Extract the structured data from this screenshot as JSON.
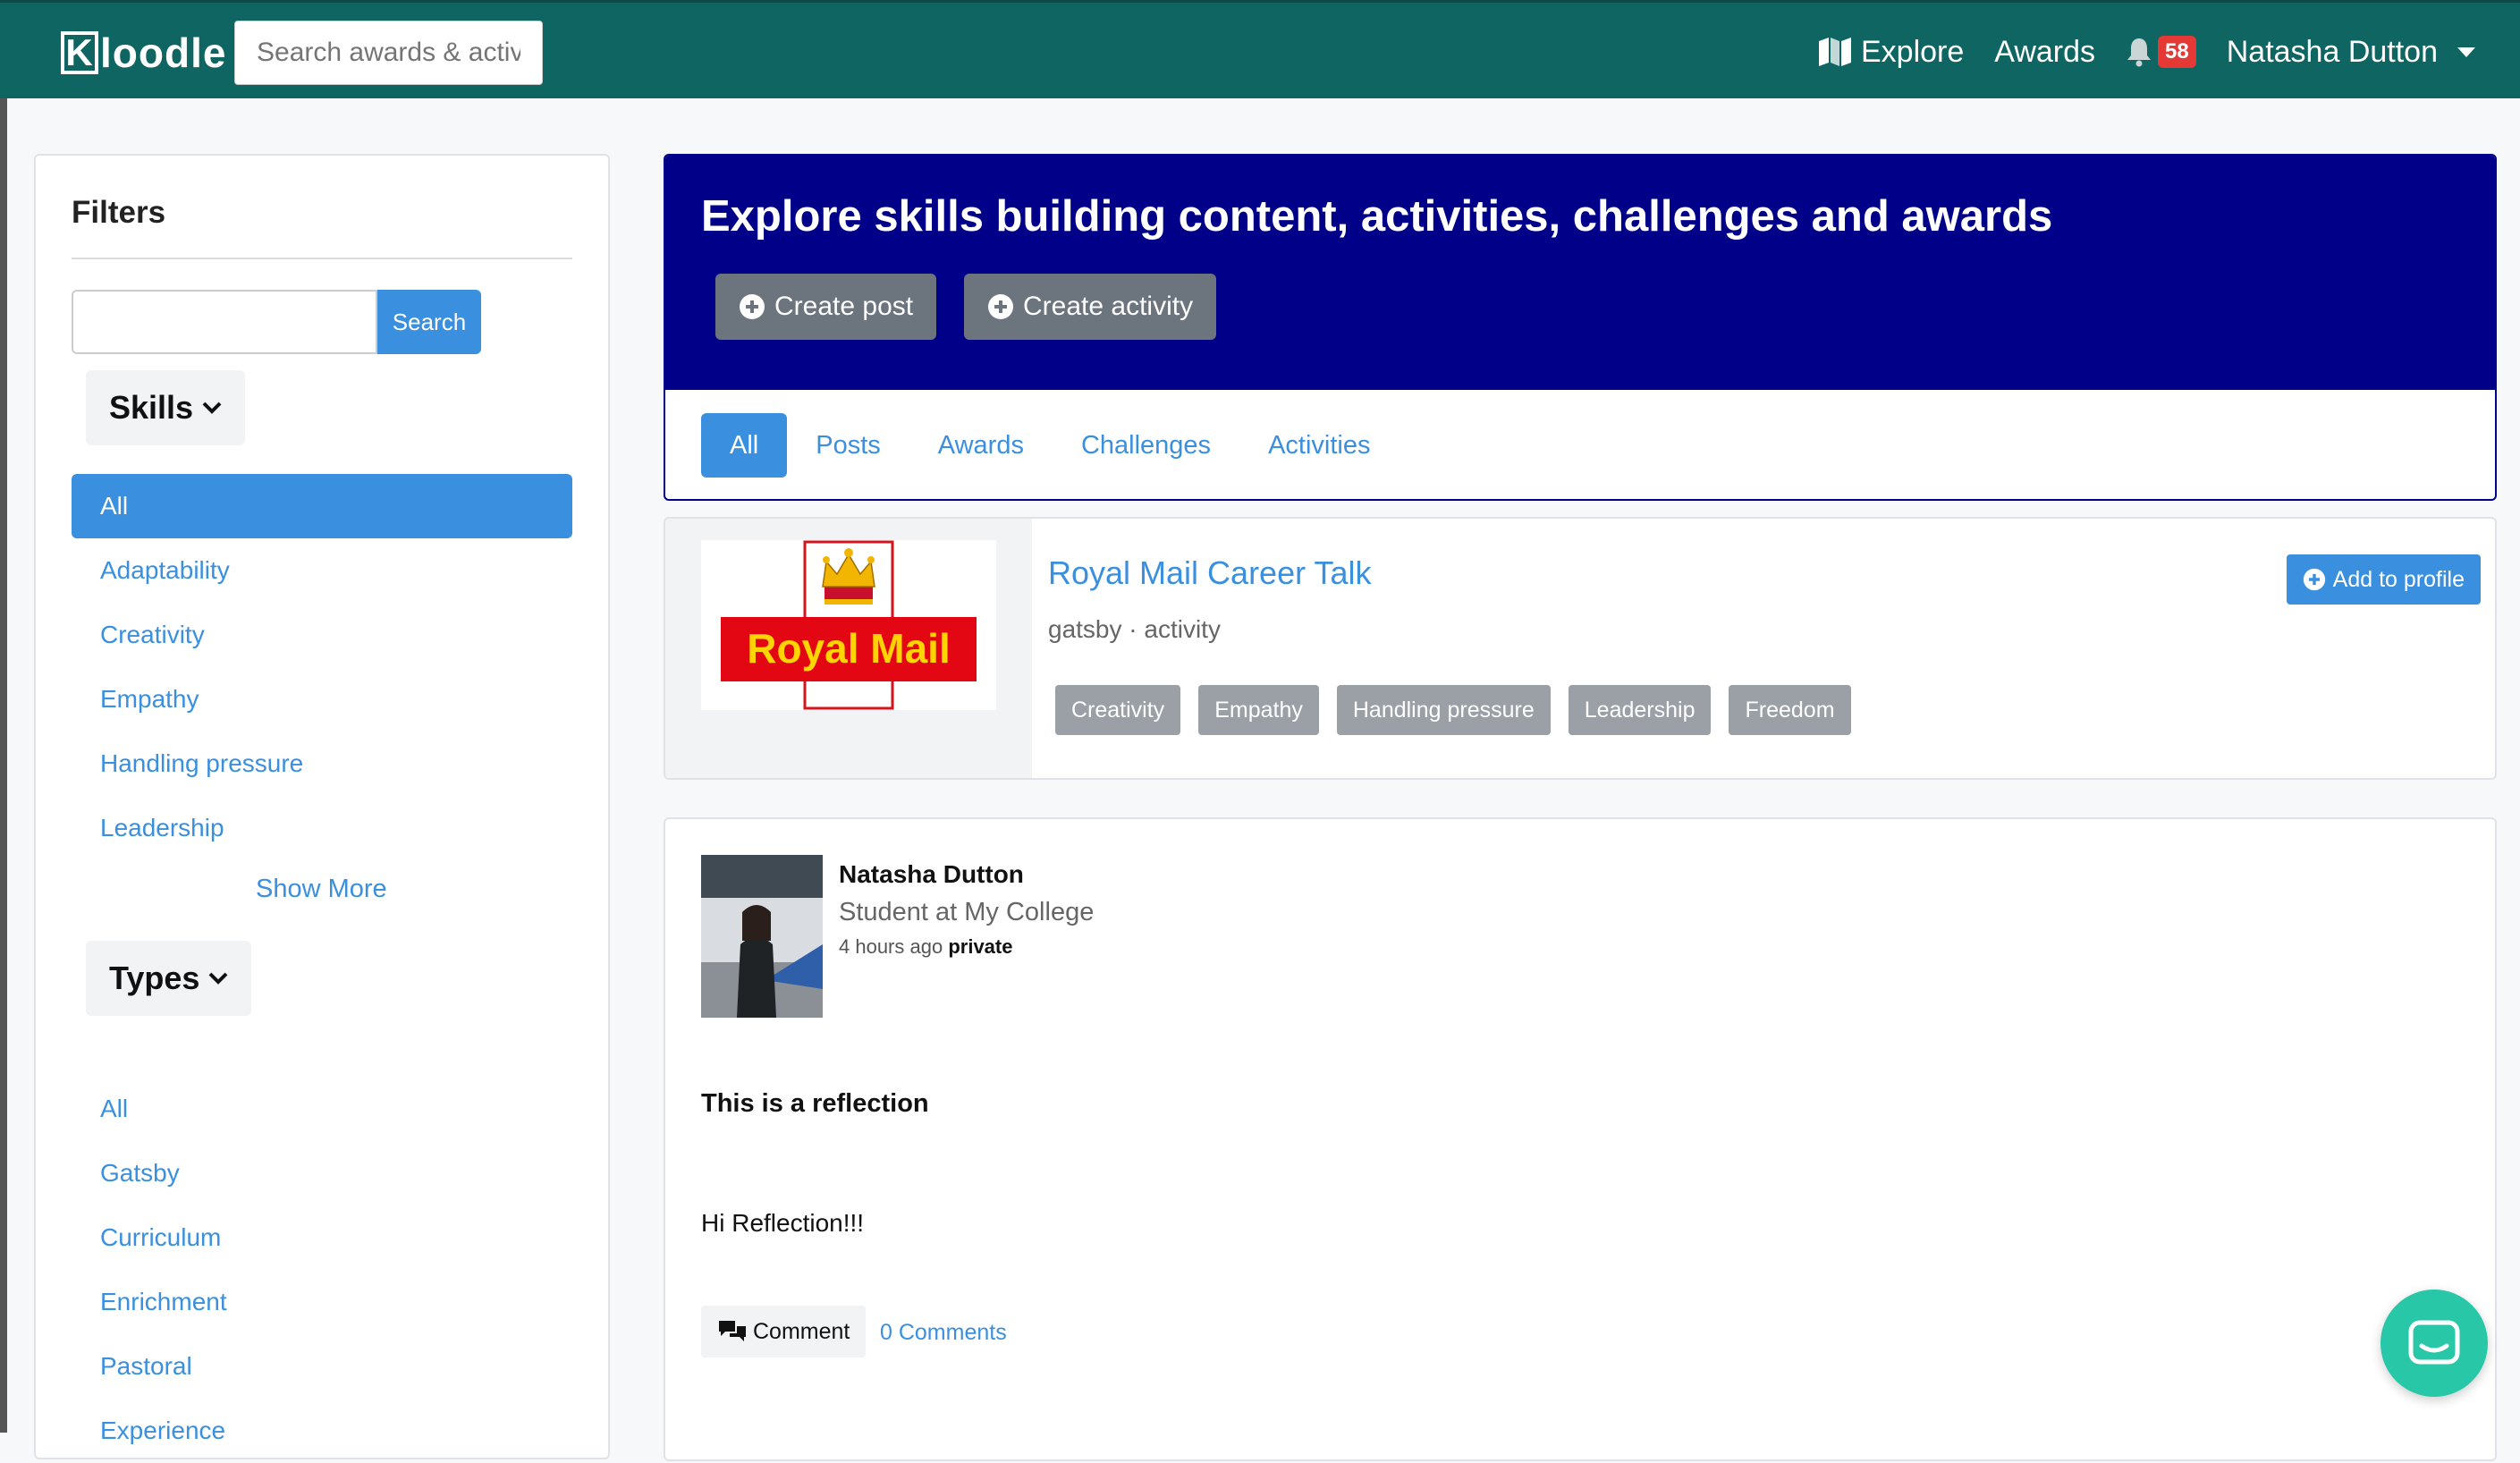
{
  "brand": {
    "logo_k": "K",
    "logo_rest": "loodle"
  },
  "navbar": {
    "search_placeholder": "Search awards & activities",
    "explore_label": "Explore",
    "awards_label": "Awards",
    "notification_count": "58",
    "user_name": "Natasha Dutton"
  },
  "filters": {
    "title": "Filters",
    "search_button": "Search",
    "skills": {
      "label": "Skills",
      "items": [
        "All",
        "Adaptability",
        "Creativity",
        "Empathy",
        "Handling pressure",
        "Leadership"
      ],
      "selected": "All",
      "show_more": "Show More"
    },
    "types": {
      "label": "Types",
      "items": [
        "All",
        "Gatsby",
        "Curriculum",
        "Enrichment",
        "Pastoral",
        "Experience"
      ]
    }
  },
  "hero": {
    "title": "Explore skills building content, activities, challenges and awards",
    "create_post": "Create post",
    "create_activity": "Create activity",
    "tabs": [
      "All",
      "Posts",
      "Awards",
      "Challenges",
      "Activities"
    ],
    "active_tab": "All"
  },
  "award_card": {
    "logo_text": "Royal Mail",
    "title": "Royal Mail Career Talk",
    "subtitle": "gatsby · activity",
    "add_button": "Add to profile",
    "tags": [
      "Creativity",
      "Empathy",
      "Handling pressure",
      "Leadership",
      "Freedom"
    ]
  },
  "post_card": {
    "author": "Natasha Dutton",
    "role": "Student at My College",
    "time": "4 hours ago",
    "visibility": "private",
    "title": "This is a reflection",
    "body": "Hi Reflection!!!",
    "comment_button": "Comment",
    "comment_count": "0 Comments"
  },
  "colors": {
    "navbar": "#0f6561",
    "hero": "#000088",
    "primary": "#3a8fde",
    "tag": "#9aa0a6",
    "chat": "#27c7a8"
  }
}
